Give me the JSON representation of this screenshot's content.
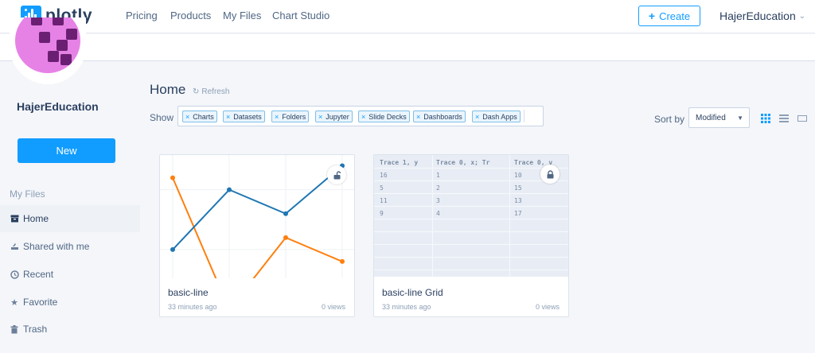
{
  "nav": {
    "brand": "plotly",
    "links": [
      "Pricing",
      "Products",
      "My Files",
      "Chart Studio"
    ],
    "create_label": "Create",
    "user": "HajerEducation"
  },
  "sidebar": {
    "username": "HajerEducation",
    "new_label": "New",
    "section": "My Files",
    "items": [
      {
        "label": "Home",
        "icon": "inbox-icon"
      },
      {
        "label": "Shared with me",
        "icon": "shared-icon"
      },
      {
        "label": "Recent",
        "icon": "clock-icon"
      },
      {
        "label": "Favorite",
        "icon": "star-icon"
      },
      {
        "label": "Trash",
        "icon": "trash-icon"
      }
    ]
  },
  "main": {
    "title": "Home",
    "refresh": "Refresh",
    "show_label": "Show",
    "filters": [
      "Charts",
      "Datasets",
      "Folders",
      "Jupyter",
      "Slide Decks",
      "Dashboards",
      "Dash Apps"
    ],
    "sort_label": "Sort by",
    "sort_value": "Modified"
  },
  "cards": [
    {
      "title": "basic-line",
      "time": "33 minutes ago",
      "views": "0 views",
      "lock": "unlock-icon"
    },
    {
      "title": "basic-line Grid",
      "time": "33 minutes ago",
      "views": "0 views",
      "lock": "lock-icon"
    }
  ],
  "grid": {
    "headers": [
      "Trace 1, y",
      "Trace 0, x; Tr",
      "Trace 0, v"
    ],
    "rows": [
      [
        "16",
        "1",
        "10"
      ],
      [
        "5",
        "2",
        "15"
      ],
      [
        "11",
        "3",
        "13"
      ],
      [
        "9",
        "4",
        "17"
      ]
    ]
  },
  "chart_data": {
    "type": "line",
    "x": [
      1,
      2,
      3,
      4
    ],
    "series": [
      {
        "values": [
          10,
          15,
          13,
          17
        ],
        "color": "#1f77b4"
      },
      {
        "values": [
          16,
          5,
          11,
          9
        ],
        "color": "#ff7f0e"
      }
    ]
  },
  "colors": {
    "accent": "#119dff",
    "text": "#2a3f5f",
    "avatar": "#e682e6"
  }
}
